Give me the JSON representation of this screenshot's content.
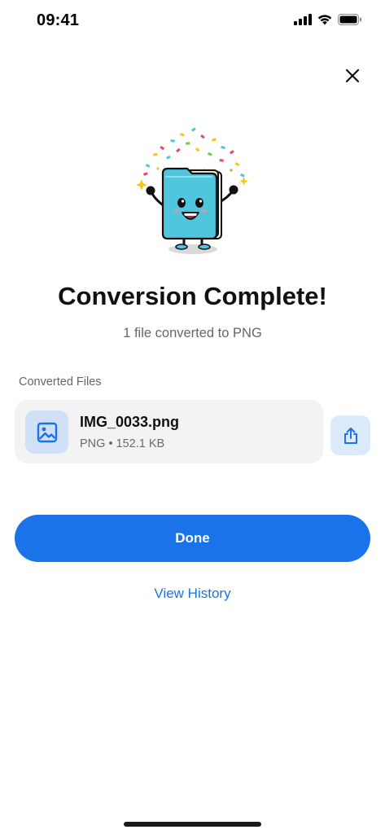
{
  "status_bar": {
    "time": "09:41",
    "signal_icon": "cellular-signal-icon",
    "wifi_icon": "wifi-icon",
    "battery_icon": "battery-icon"
  },
  "header": {
    "close_icon": "close-icon"
  },
  "hero": {
    "illustration": "celebrating-folder-illustration"
  },
  "result": {
    "title": "Conversion Complete!",
    "subtitle": "1 file converted to PNG"
  },
  "files": {
    "section_label": "Converted Files",
    "items": [
      {
        "name": "IMG_0033.png",
        "meta": "PNG • 152.1 KB",
        "thumb_icon": "image-icon",
        "share_icon": "share-icon"
      }
    ]
  },
  "actions": {
    "done_label": "Done",
    "history_label": "View History"
  },
  "colors": {
    "accent": "#1a73e8",
    "card_bg": "#f3f3f4",
    "thumb_bg": "#cfe0f7",
    "share_bg": "#dcebfb",
    "folder": "#4fc6de"
  }
}
